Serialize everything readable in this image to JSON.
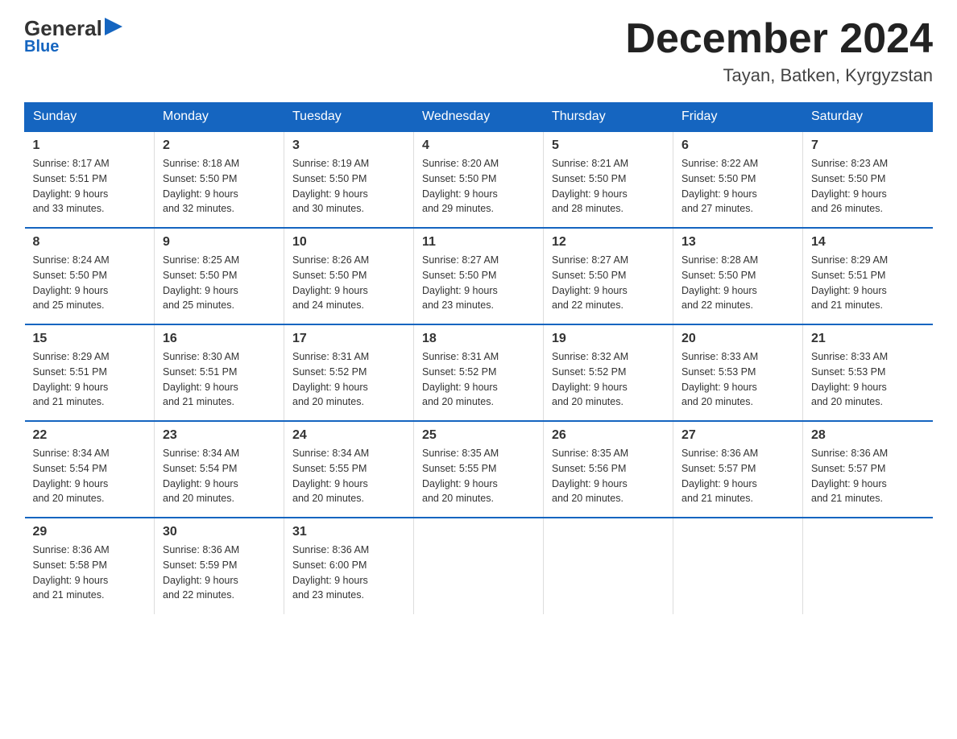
{
  "logo": {
    "general": "General",
    "arrow": "▶",
    "blue": "Blue"
  },
  "title": "December 2024",
  "location": "Tayan, Batken, Kyrgyzstan",
  "days_of_week": [
    "Sunday",
    "Monday",
    "Tuesday",
    "Wednesday",
    "Thursday",
    "Friday",
    "Saturday"
  ],
  "weeks": [
    [
      {
        "day": "1",
        "sunrise": "8:17 AM",
        "sunset": "5:51 PM",
        "daylight": "9 hours and 33 minutes."
      },
      {
        "day": "2",
        "sunrise": "8:18 AM",
        "sunset": "5:50 PM",
        "daylight": "9 hours and 32 minutes."
      },
      {
        "day": "3",
        "sunrise": "8:19 AM",
        "sunset": "5:50 PM",
        "daylight": "9 hours and 30 minutes."
      },
      {
        "day": "4",
        "sunrise": "8:20 AM",
        "sunset": "5:50 PM",
        "daylight": "9 hours and 29 minutes."
      },
      {
        "day": "5",
        "sunrise": "8:21 AM",
        "sunset": "5:50 PM",
        "daylight": "9 hours and 28 minutes."
      },
      {
        "day": "6",
        "sunrise": "8:22 AM",
        "sunset": "5:50 PM",
        "daylight": "9 hours and 27 minutes."
      },
      {
        "day": "7",
        "sunrise": "8:23 AM",
        "sunset": "5:50 PM",
        "daylight": "9 hours and 26 minutes."
      }
    ],
    [
      {
        "day": "8",
        "sunrise": "8:24 AM",
        "sunset": "5:50 PM",
        "daylight": "9 hours and 25 minutes."
      },
      {
        "day": "9",
        "sunrise": "8:25 AM",
        "sunset": "5:50 PM",
        "daylight": "9 hours and 25 minutes."
      },
      {
        "day": "10",
        "sunrise": "8:26 AM",
        "sunset": "5:50 PM",
        "daylight": "9 hours and 24 minutes."
      },
      {
        "day": "11",
        "sunrise": "8:27 AM",
        "sunset": "5:50 PM",
        "daylight": "9 hours and 23 minutes."
      },
      {
        "day": "12",
        "sunrise": "8:27 AM",
        "sunset": "5:50 PM",
        "daylight": "9 hours and 22 minutes."
      },
      {
        "day": "13",
        "sunrise": "8:28 AM",
        "sunset": "5:50 PM",
        "daylight": "9 hours and 22 minutes."
      },
      {
        "day": "14",
        "sunrise": "8:29 AM",
        "sunset": "5:51 PM",
        "daylight": "9 hours and 21 minutes."
      }
    ],
    [
      {
        "day": "15",
        "sunrise": "8:29 AM",
        "sunset": "5:51 PM",
        "daylight": "9 hours and 21 minutes."
      },
      {
        "day": "16",
        "sunrise": "8:30 AM",
        "sunset": "5:51 PM",
        "daylight": "9 hours and 21 minutes."
      },
      {
        "day": "17",
        "sunrise": "8:31 AM",
        "sunset": "5:52 PM",
        "daylight": "9 hours and 20 minutes."
      },
      {
        "day": "18",
        "sunrise": "8:31 AM",
        "sunset": "5:52 PM",
        "daylight": "9 hours and 20 minutes."
      },
      {
        "day": "19",
        "sunrise": "8:32 AM",
        "sunset": "5:52 PM",
        "daylight": "9 hours and 20 minutes."
      },
      {
        "day": "20",
        "sunrise": "8:33 AM",
        "sunset": "5:53 PM",
        "daylight": "9 hours and 20 minutes."
      },
      {
        "day": "21",
        "sunrise": "8:33 AM",
        "sunset": "5:53 PM",
        "daylight": "9 hours and 20 minutes."
      }
    ],
    [
      {
        "day": "22",
        "sunrise": "8:34 AM",
        "sunset": "5:54 PM",
        "daylight": "9 hours and 20 minutes."
      },
      {
        "day": "23",
        "sunrise": "8:34 AM",
        "sunset": "5:54 PM",
        "daylight": "9 hours and 20 minutes."
      },
      {
        "day": "24",
        "sunrise": "8:34 AM",
        "sunset": "5:55 PM",
        "daylight": "9 hours and 20 minutes."
      },
      {
        "day": "25",
        "sunrise": "8:35 AM",
        "sunset": "5:55 PM",
        "daylight": "9 hours and 20 minutes."
      },
      {
        "day": "26",
        "sunrise": "8:35 AM",
        "sunset": "5:56 PM",
        "daylight": "9 hours and 20 minutes."
      },
      {
        "day": "27",
        "sunrise": "8:36 AM",
        "sunset": "5:57 PM",
        "daylight": "9 hours and 21 minutes."
      },
      {
        "day": "28",
        "sunrise": "8:36 AM",
        "sunset": "5:57 PM",
        "daylight": "9 hours and 21 minutes."
      }
    ],
    [
      {
        "day": "29",
        "sunrise": "8:36 AM",
        "sunset": "5:58 PM",
        "daylight": "9 hours and 21 minutes."
      },
      {
        "day": "30",
        "sunrise": "8:36 AM",
        "sunset": "5:59 PM",
        "daylight": "9 hours and 22 minutes."
      },
      {
        "day": "31",
        "sunrise": "8:36 AM",
        "sunset": "6:00 PM",
        "daylight": "9 hours and 23 minutes."
      },
      {
        "day": "",
        "sunrise": "",
        "sunset": "",
        "daylight": ""
      },
      {
        "day": "",
        "sunrise": "",
        "sunset": "",
        "daylight": ""
      },
      {
        "day": "",
        "sunrise": "",
        "sunset": "",
        "daylight": ""
      },
      {
        "day": "",
        "sunrise": "",
        "sunset": "",
        "daylight": ""
      }
    ]
  ],
  "labels": {
    "sunrise": "Sunrise:",
    "sunset": "Sunset:",
    "daylight": "Daylight:"
  }
}
